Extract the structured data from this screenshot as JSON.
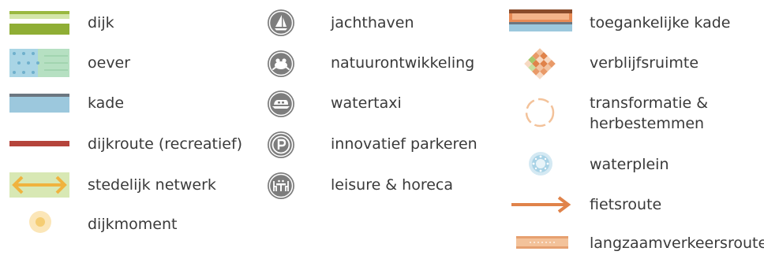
{
  "columns": [
    {
      "items": [
        {
          "id": "dijk",
          "label": "dijk",
          "icon": "dike-band-icon"
        },
        {
          "id": "oever",
          "label": "oever",
          "icon": "riverbank-pattern-icon"
        },
        {
          "id": "kade",
          "label": "kade",
          "icon": "quay-band-icon"
        },
        {
          "id": "dijkroute",
          "label": "dijkroute (recreatief)",
          "icon": "dike-route-line-icon"
        },
        {
          "id": "stedelijk",
          "label": "stedelijk netwerk",
          "icon": "urban-network-arrow-icon"
        },
        {
          "id": "dijkmoment",
          "label": "dijkmoment",
          "icon": "dike-moment-dot-icon"
        }
      ]
    },
    {
      "items": [
        {
          "id": "jachthaven",
          "label": "jachthaven",
          "icon": "sailboat-icon"
        },
        {
          "id": "natuur",
          "label": "natuurontwikkeling",
          "icon": "frog-icon"
        },
        {
          "id": "watertaxi",
          "label": "watertaxi",
          "icon": "water-taxi-icon"
        },
        {
          "id": "parkeren",
          "label": "innovatief parkeren",
          "icon": "parking-icon"
        },
        {
          "id": "leisure",
          "label": "leisure & horeca",
          "icon": "dining-table-icon"
        }
      ]
    },
    {
      "items": [
        {
          "id": "kade_toeg",
          "label": "toegankelijke kade",
          "icon": "accessible-quay-icon"
        },
        {
          "id": "verblijf",
          "label": "verblijfsruimte",
          "icon": "stay-space-mosaic-icon"
        },
        {
          "id": "transform",
          "label": "transformatie & herbestemmen",
          "icon": "transformation-circle-icon"
        },
        {
          "id": "waterplein",
          "label": "waterplein",
          "icon": "water-square-icon"
        },
        {
          "id": "fiets",
          "label": "fietsroute",
          "icon": "bike-route-arrow-icon"
        },
        {
          "id": "langzaam",
          "label": "langzaamverkeersroute",
          "icon": "slow-traffic-route-icon"
        }
      ]
    }
  ],
  "colors": {
    "dike_green_light": "#cfe3a6",
    "dike_green_dark": "#94b23a",
    "bank_blue": "#a8d6e6",
    "bank_green": "#b5dfc0",
    "quay_blue": "#9cc7dc",
    "quay_grey": "#6b7680",
    "route_red": "#b5433a",
    "network_bg": "#d6e6b0",
    "network_arrow": "#f0b33e",
    "moment": "#f7d58a",
    "icon_grey": "#7c7c7c",
    "orange": "#e0834a",
    "orange_light": "#f3c29a"
  }
}
